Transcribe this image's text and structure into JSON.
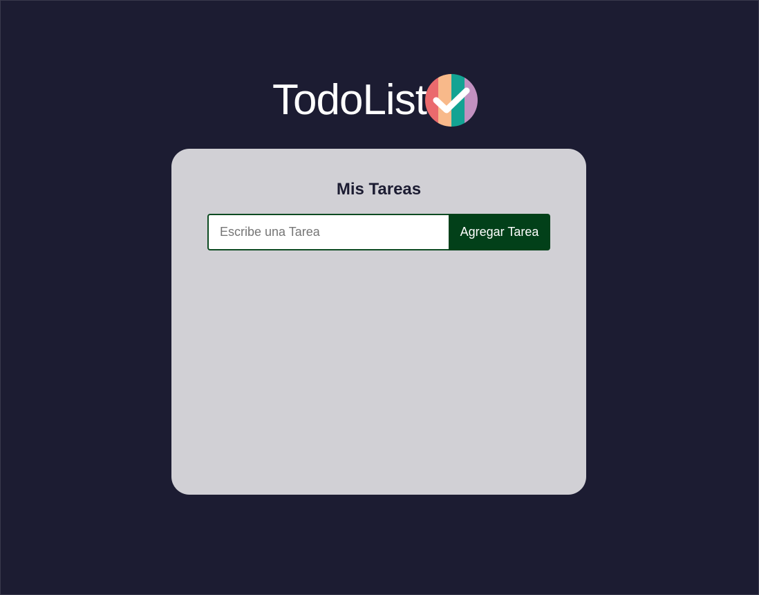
{
  "logo": {
    "text": "TodoList",
    "icon": "checkmark-badge-icon",
    "stripe_colors": [
      "#ea6a6d",
      "#f8b98a",
      "#13a393",
      "#c291c0"
    ]
  },
  "card": {
    "title": "Mis Tareas"
  },
  "form": {
    "input_placeholder": "Escribe una Tarea",
    "input_value": "",
    "button_label": "Agregar Tarea"
  },
  "tasks": [],
  "colors": {
    "background": "#1c1c32",
    "card": "#d1d0d5",
    "button": "#024019",
    "input_border": "#0c4a21"
  }
}
